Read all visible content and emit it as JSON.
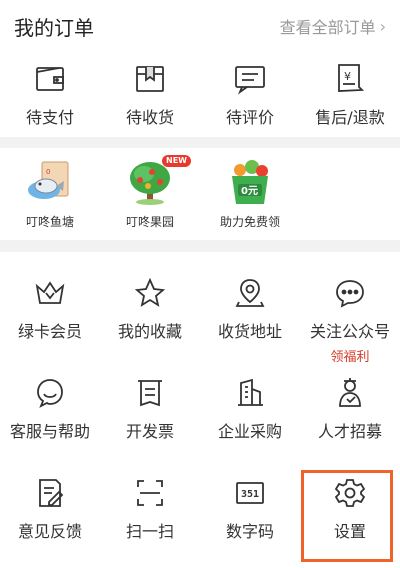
{
  "orders": {
    "title": "我的订单",
    "view_all": "查看全部订单",
    "items": [
      {
        "label": "待支付",
        "icon": "wallet-icon"
      },
      {
        "label": "待收货",
        "icon": "package-icon"
      },
      {
        "label": "待评价",
        "icon": "comment-icon"
      },
      {
        "label": "售后/退款",
        "icon": "refund-icon"
      }
    ]
  },
  "promos": {
    "items": [
      {
        "label": "叮咚鱼塘",
        "icon": "fish-pond-icon"
      },
      {
        "label": "叮咚果园",
        "icon": "orchard-tree-icon",
        "badge": "NEW"
      },
      {
        "label": "助力免费领",
        "icon": "free-gift-basket-icon",
        "badge_text": "0元"
      }
    ]
  },
  "services": {
    "rows": [
      [
        {
          "label": "绿卡会员",
          "icon": "crown-icon"
        },
        {
          "label": "我的收藏",
          "icon": "star-icon"
        },
        {
          "label": "收货地址",
          "icon": "location-pin-icon"
        },
        {
          "label": "关注公众号",
          "icon": "chat-bubble-icon",
          "sub": "领福利"
        }
      ],
      [
        {
          "label": "客服与帮助",
          "icon": "customer-service-icon"
        },
        {
          "label": "开发票",
          "icon": "receipt-icon"
        },
        {
          "label": "企业采购",
          "icon": "building-icon"
        },
        {
          "label": "人才招募",
          "icon": "recruit-person-icon"
        }
      ],
      [
        {
          "label": "意见反馈",
          "icon": "feedback-edit-icon"
        },
        {
          "label": "扫一扫",
          "icon": "scan-icon"
        },
        {
          "label": "数字码",
          "icon": "digit-code-icon",
          "icon_text": "351"
        },
        {
          "label": "设置",
          "icon": "gear-icon"
        }
      ]
    ]
  },
  "colors": {
    "accent": "#d63a2a",
    "highlight_border": "#f0622a",
    "icon_stroke": "#333333"
  }
}
